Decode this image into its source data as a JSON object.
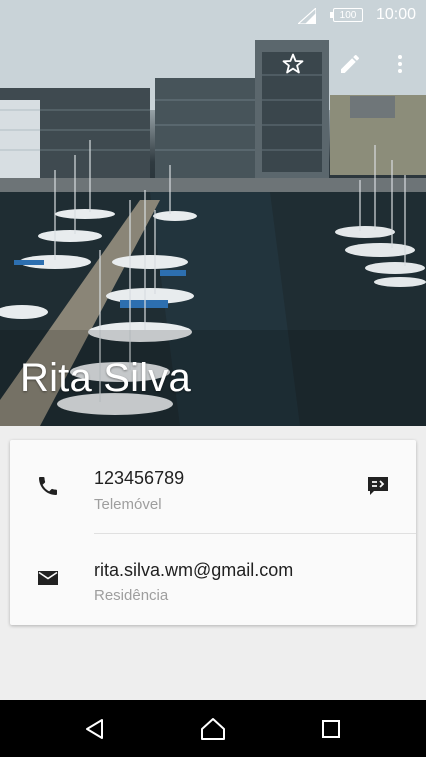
{
  "status": {
    "time": "10:00",
    "battery": "100"
  },
  "contact": {
    "name": "Rita Silva"
  },
  "details": [
    {
      "value": "123456789",
      "label": "Telemóvel"
    },
    {
      "value": "rita.silva.wm@gmail.com",
      "label": "Residência"
    }
  ],
  "icons": {
    "favorite": "star-outline-icon",
    "edit": "pencil-icon",
    "more": "more-vert-icon",
    "phone": "phone-icon",
    "message": "message-icon",
    "email": "email-icon",
    "back": "back-triangle-icon",
    "home": "home-icon",
    "recents": "recents-square-icon"
  }
}
